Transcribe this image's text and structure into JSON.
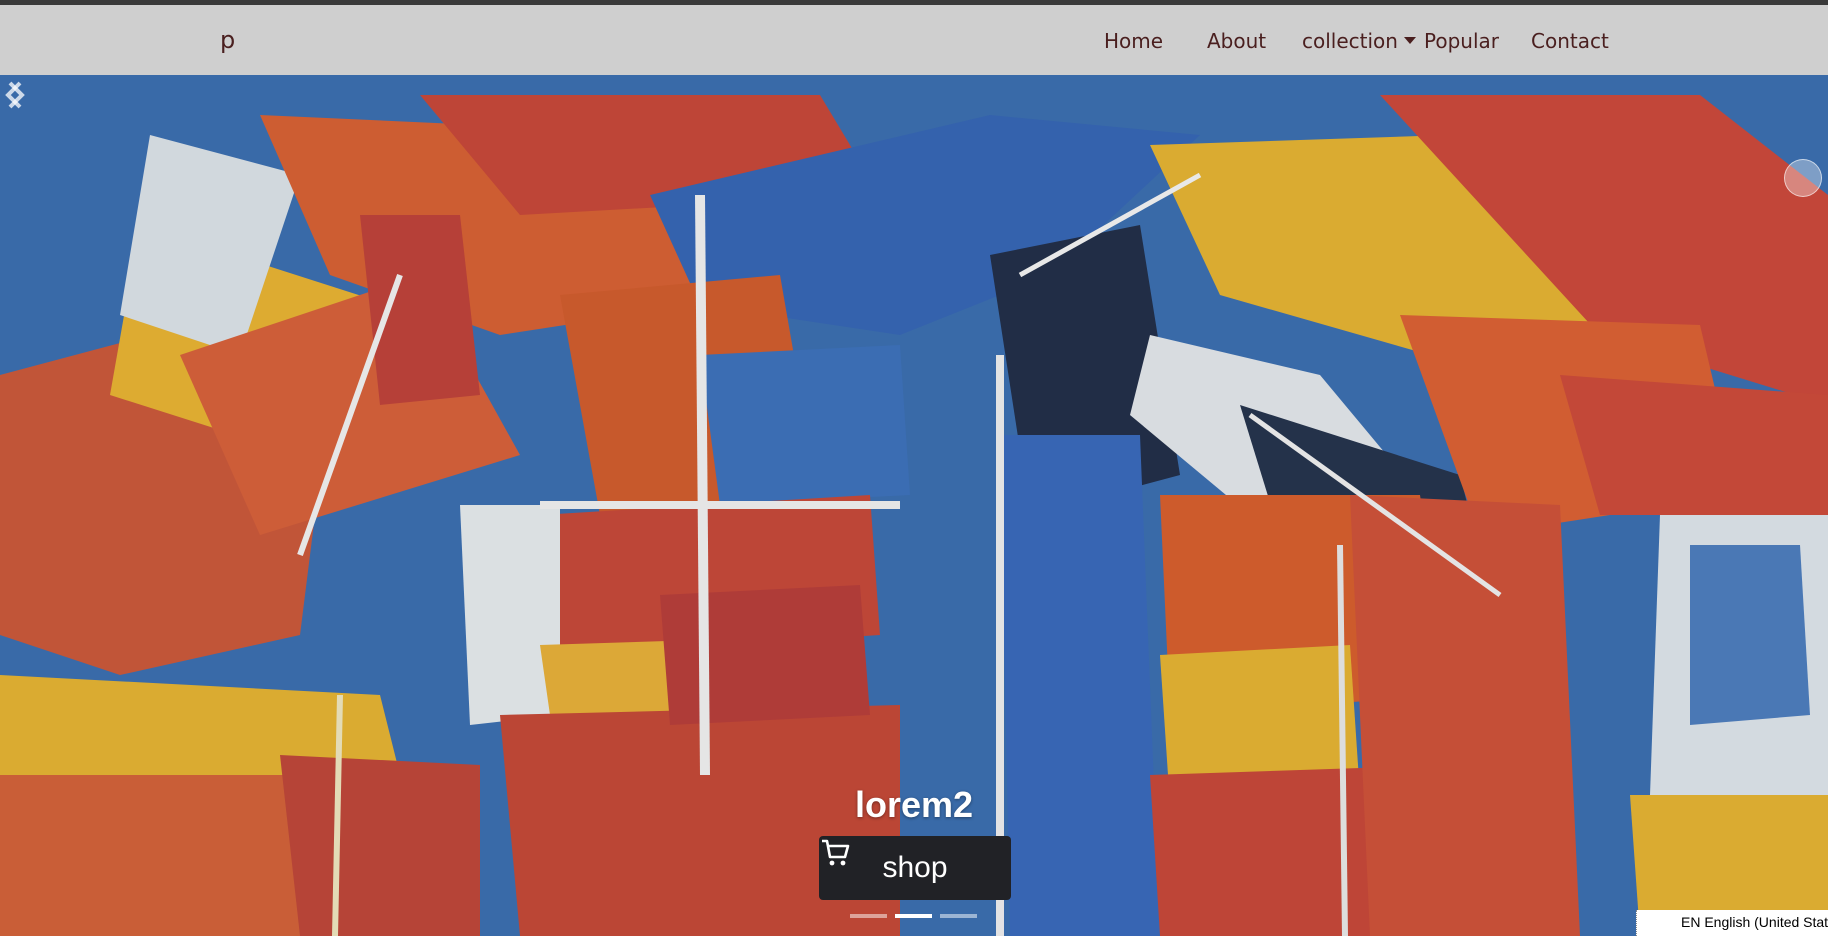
{
  "navbar": {
    "brand": "p",
    "links": [
      "Home",
      "About",
      "collection",
      "Popular",
      "Contact"
    ]
  },
  "carousel": {
    "caption": "lorem2",
    "button_label": "shop",
    "button_icon": "cart-icon",
    "slide_count": 3,
    "active_slide": 2
  },
  "language_bar": {
    "text": "EN English (United States)"
  },
  "colors": {
    "navbar_bg": "#cfcfcf",
    "nav_text": "#4a1f1f",
    "button_bg": "#212226"
  }
}
